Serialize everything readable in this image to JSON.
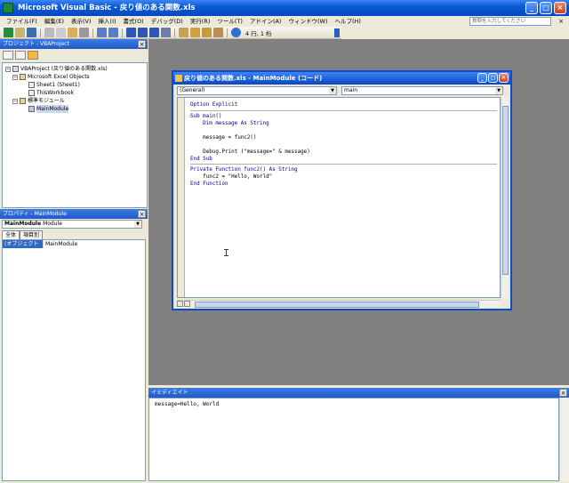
{
  "window": {
    "title": "Microsoft Visual Basic - 戻り値のある関数.xls",
    "minimize": "_",
    "maximize": "□",
    "close": "×"
  },
  "menu": [
    "ファイル(F)",
    "編集(E)",
    "表示(V)",
    "挿入(I)",
    "書式(O)",
    "デバッグ(D)",
    "実行(R)",
    "ツール(T)",
    "アドイン(A)",
    "ウィンドウ(W)",
    "ヘルプ(H)"
  ],
  "help_box": {
    "placeholder": "質問を入力してください"
  },
  "menubar_close": "×",
  "toolbar": {
    "position": "4 行, 1 桁"
  },
  "project_pane": {
    "title": "プロジェクト - VBAProject",
    "close": "×",
    "tree": [
      {
        "label": "VBAProject (戻り値のある関数.xls)",
        "toggle": "−"
      },
      {
        "label": "Microsoft Excel Objects",
        "toggle": "−"
      },
      {
        "label": "Sheet1 (Sheet1)"
      },
      {
        "label": "ThisWorkbook"
      },
      {
        "label": "標準モジュール",
        "toggle": "−"
      },
      {
        "label": "MainModule"
      }
    ]
  },
  "properties_pane": {
    "title": "プロパティ - MainModule",
    "close": "×",
    "object": "MainModule",
    "object_type": "Module",
    "tabs": [
      "全体",
      "項目別"
    ],
    "rows": [
      {
        "name": "(オブジェクト名)",
        "value": "MainModule"
      }
    ]
  },
  "code_window": {
    "title": "戻り値のある関数.xls - MainModule (コード)",
    "object_combo": "(General)",
    "procedure_combo": "main",
    "lines": [
      "Option Explicit",
      "Sub main()",
      "    Dim message As String",
      "",
      "    message = func2()",
      "",
      "    Debug.Print (\"message=\" & message)",
      "End Sub",
      "Private Function func2() As String",
      "    func2 = \"Hello, World\"",
      "End Function"
    ]
  },
  "immediate_pane": {
    "title": "イミディエイト",
    "close": "×",
    "output": "message=Hello, World"
  },
  "colors": {
    "titlebar": "#0a5bd8",
    "workspace": "#808080",
    "selection": "#316ac5",
    "face": "#ece9d8"
  }
}
